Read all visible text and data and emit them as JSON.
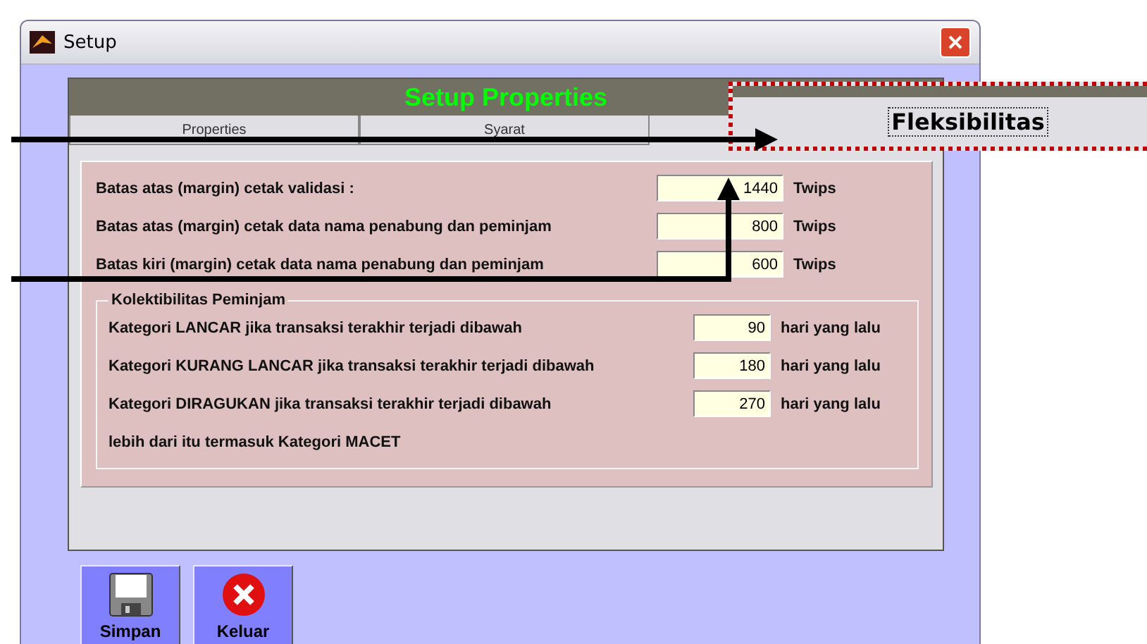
{
  "window": {
    "title": "Setup"
  },
  "header_title": "Setup Properties",
  "tabs": [
    {
      "label": "Properties",
      "selected": false
    },
    {
      "label": "Syarat",
      "selected": false
    },
    {
      "label": "Fleksibilitas",
      "selected": true
    }
  ],
  "margins": [
    {
      "label": "Batas atas (margin) cetak validasi :",
      "value": "1440",
      "unit": "Twips"
    },
    {
      "label": "Batas atas (margin) cetak data nama penabung dan peminjam",
      "value": "800",
      "unit": "Twips"
    },
    {
      "label": "Batas kiri (margin) cetak data nama penabung dan peminjam",
      "value": "600",
      "unit": "Twips"
    }
  ],
  "group": {
    "title": "Kolektibilitas Peminjam",
    "rows": [
      {
        "label": "Kategori LANCAR jika transaksi terakhir terjadi dibawah",
        "value": "90",
        "unit": "hari yang lalu"
      },
      {
        "label": "Kategori KURANG LANCAR jika transaksi terakhir terjadi dibawah",
        "value": "180",
        "unit": "hari yang lalu"
      },
      {
        "label": "Kategori DIRAGUKAN jika transaksi terakhir terjadi dibawah",
        "value": "270",
        "unit": "hari yang lalu"
      }
    ],
    "note": "lebih dari itu termasuk Kategori MACET"
  },
  "buttons": [
    {
      "label": "Simpan",
      "kind": "save"
    },
    {
      "label": "Keluar",
      "kind": "exit"
    }
  ]
}
